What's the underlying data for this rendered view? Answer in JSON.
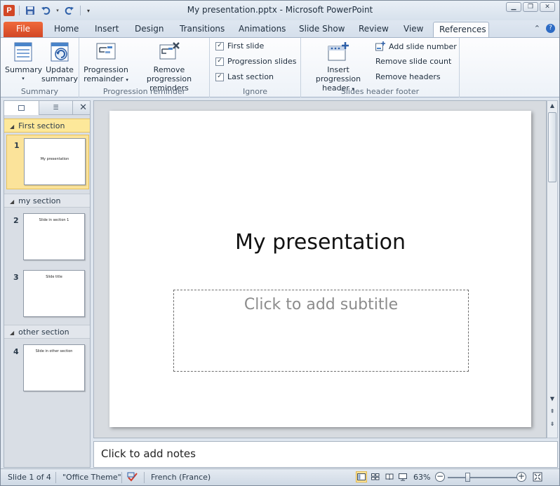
{
  "window": {
    "app_icon_letter": "P",
    "title": "My presentation.pptx - Microsoft PowerPoint"
  },
  "ribbon_tabs": {
    "file": "File",
    "home": "Home",
    "insert": "Insert",
    "design": "Design",
    "transitions": "Transitions",
    "animations": "Animations",
    "slide_show": "Slide Show",
    "review": "Review",
    "view": "View",
    "references": "References"
  },
  "ribbon": {
    "summary_group": {
      "label": "Summary",
      "summary_btn": "Summary",
      "update_line1": "Update",
      "update_line2": "summary"
    },
    "progression_group": {
      "label": "Progression reminder",
      "progression_line1": "Progression",
      "progression_line2": "remainder",
      "remove_line1": "Remove progression",
      "remove_line2": "reminders"
    },
    "ignore_group": {
      "label": "Ignore",
      "first_slide": "First slide",
      "progression_slides": "Progression slides",
      "last_section": "Last section",
      "first_slide_checked": true,
      "progression_slides_checked": true,
      "last_section_checked": true
    },
    "header_group": {
      "label": "Slides header  footer",
      "insert_line1": "Insert progression",
      "insert_line2": "header",
      "add_slide_number": "Add slide number",
      "remove_slide_count": "Remove slide count",
      "remove_headers": "Remove headers"
    }
  },
  "pane": {
    "sections": [
      {
        "name": "First section"
      },
      {
        "name": "my section"
      },
      {
        "name": "other section"
      }
    ],
    "slides": [
      {
        "num": "1",
        "text": "My presentation"
      },
      {
        "num": "2",
        "text": "Slide in section 1"
      },
      {
        "num": "3",
        "text": "Slide title"
      },
      {
        "num": "4",
        "text": "Slide in other section"
      }
    ]
  },
  "slide": {
    "title": "My presentation",
    "subtitle_placeholder": "Click to add subtitle"
  },
  "notes": {
    "placeholder": "Click to add notes"
  },
  "status": {
    "slide_info": "Slide 1 of 4",
    "theme": "\"Office Theme\"",
    "language": "French (France)",
    "zoom": "63%",
    "zoom_fraction": 0.63
  },
  "colors": {
    "file_tab": "#d24726",
    "selected_section": "#fde89a",
    "ribbon_bg": "#fdfdfe"
  }
}
